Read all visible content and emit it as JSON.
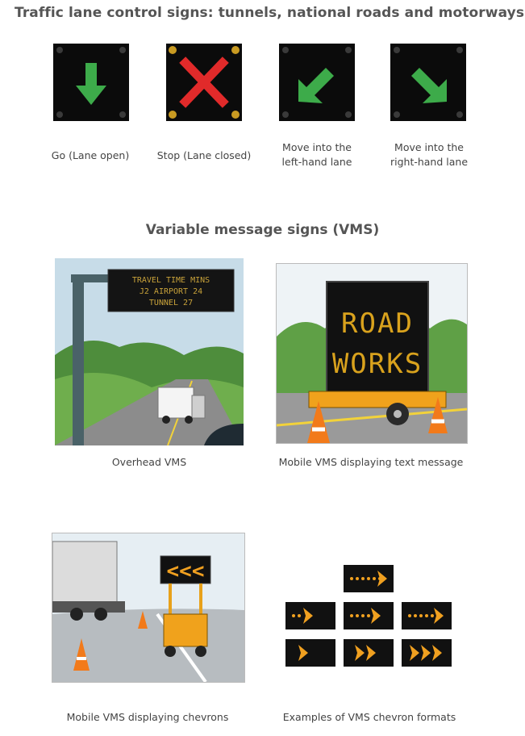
{
  "lane_section": {
    "title": "Traffic lane control signs: tunnels, national roads and motorways",
    "signs": [
      {
        "icon": "down-arrow-green-icon",
        "caption_lines": [
          "Go (Lane open)"
        ]
      },
      {
        "icon": "red-cross-icon",
        "caption_lines": [
          "Stop (Lane closed)"
        ]
      },
      {
        "icon": "down-left-arrow-green-icon",
        "caption_lines": [
          "Move into the",
          "left-hand lane"
        ]
      },
      {
        "icon": "down-right-arrow-green-icon",
        "caption_lines": [
          "Move into the",
          "right-hand lane"
        ]
      }
    ],
    "colors": {
      "green": "#3dab4a",
      "red": "#e12a2a",
      "amber": "#c99b22",
      "sign_bg": "#0b0b0b"
    }
  },
  "vms_section": {
    "title": "Variable message signs (VMS)",
    "images": [
      {
        "caption": "Overhead VMS",
        "sign_lines": [
          "TRAVEL TIME MINS",
          "J2 AIRPORT 24",
          "TUNNEL 27"
        ]
      },
      {
        "caption": "Mobile VMS displaying text message",
        "sign_lines": [
          "ROAD",
          "WORKS"
        ]
      },
      {
        "caption": "Mobile VMS displaying chevrons",
        "sign_lines": [
          "<<<"
        ]
      },
      {
        "caption": "Examples of VMS chevron formats"
      }
    ],
    "colors": {
      "led_amber": "#f0a020",
      "sky": "#dde9ef",
      "foliage": "#5fa046"
    }
  }
}
